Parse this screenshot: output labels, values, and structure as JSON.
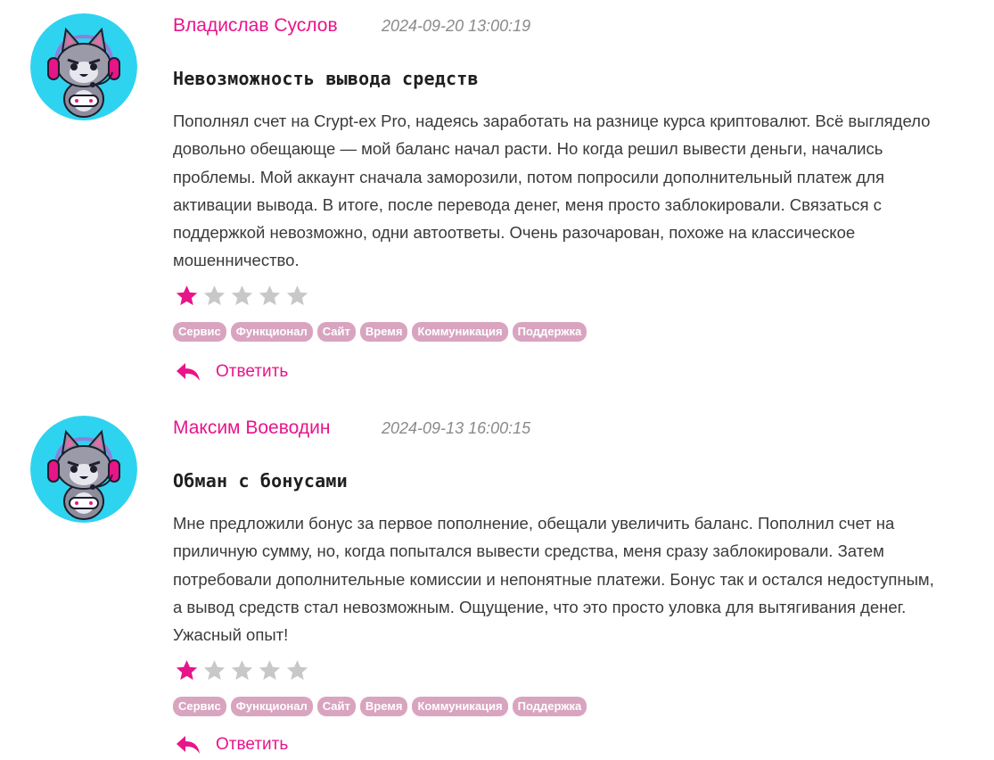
{
  "reviews": [
    {
      "author": "Владислав Суслов",
      "date": "2024-09-20 13:00:19",
      "title": "Невозможность вывода средств",
      "body_lines": [
        "Пополнял счет на Crypt-ex Pro, надеясь заработать на разнице курса криптовалют. Всё выглядело",
        "довольно обещающе — мой баланс начал расти. Но когда решил вывести деньги, начались",
        "проблемы. Мой аккаунт сначала заморозили, потом попросили дополнительный платеж для",
        "активации вывода. В итоге, после перевода денег, меня просто заблокировали. Связаться с",
        "поддержкой невозможно, одни автоответы. Очень разочарован, похоже на классическое",
        "мошенничество."
      ],
      "rating": 1,
      "rating_max": 5,
      "tags": [
        "Сервис",
        "Функционал",
        "Сайт",
        "Время",
        "Коммуникация",
        "Поддержка"
      ],
      "reply_label": "Ответить",
      "avatar_icon": "cat-gamer-avatar-icon"
    },
    {
      "author": "Максим Воеводин",
      "date": "2024-09-13 16:00:15",
      "title": "Обман с бонусами",
      "body_lines": [
        "Мне предложили бонус за первое пополнение, обещали увеличить баланс. Пополнил счет на",
        "приличную сумму, но, когда попытался вывести средства, меня сразу заблокировали. Затем",
        "потребовали дополнительные комиссии и непонятные платежи. Бонус так и остался недоступным,",
        "а вывод средств стал невозможным. Ощущение, что это просто уловка для вытягивания денег.",
        "Ужасный опыт!"
      ],
      "rating": 1,
      "rating_max": 5,
      "tags": [
        "Сервис",
        "Функционал",
        "Сайт",
        "Время",
        "Коммуникация",
        "Поддержка"
      ],
      "reply_label": "Ответить",
      "avatar_icon": "cat-gamer-avatar-icon"
    }
  ],
  "colors": {
    "accent": "#e8148a",
    "tag_bg": "#d9a4c0",
    "star_filled": "#e8148a",
    "star_empty": "#c8c8c8",
    "avatar_bg": "#2ed3f0",
    "date": "#8a8a8a"
  }
}
